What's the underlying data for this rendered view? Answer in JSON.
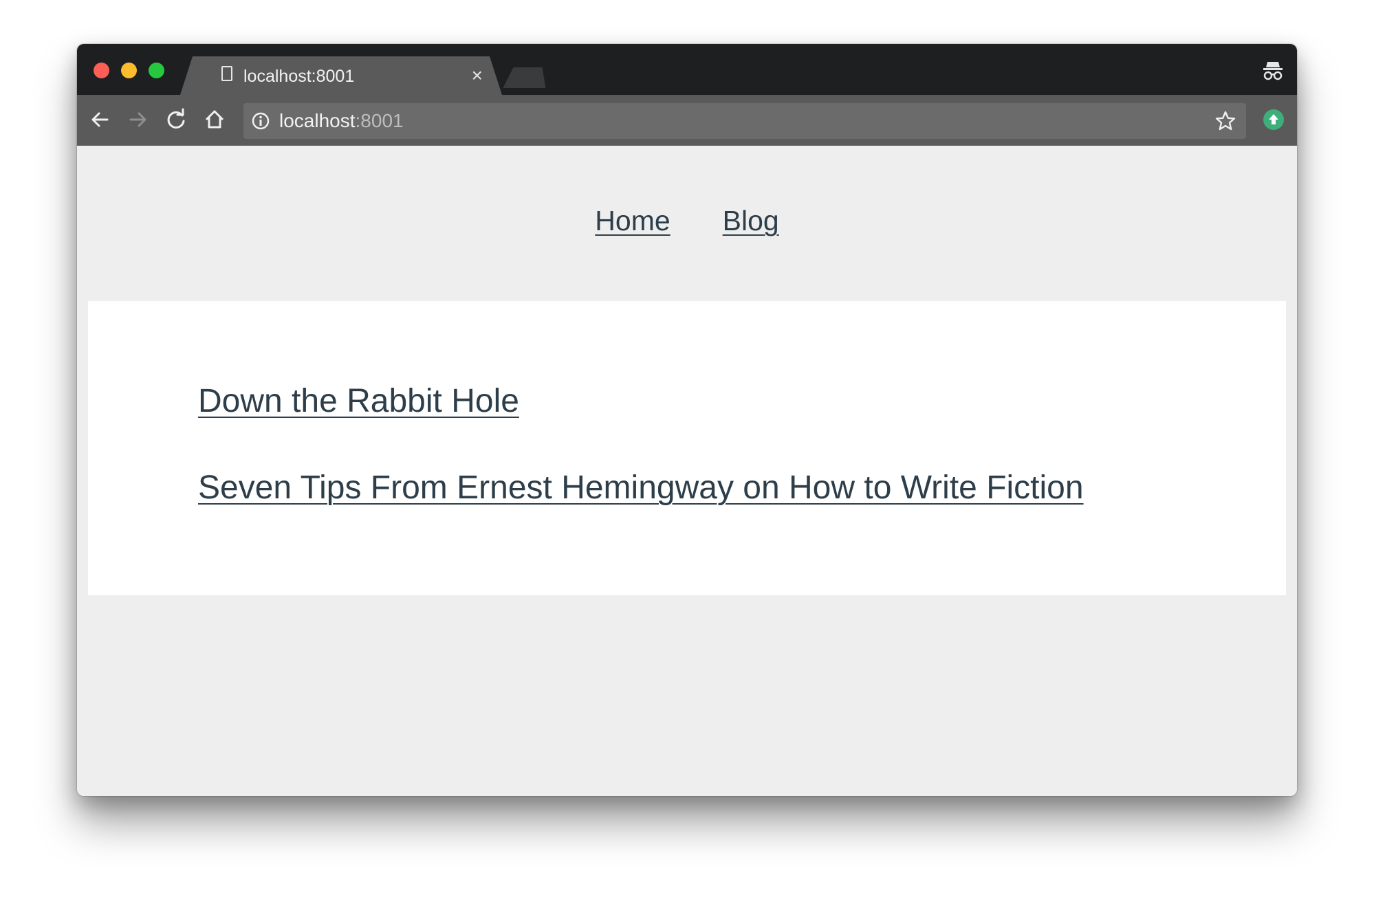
{
  "browser": {
    "tab": {
      "title": "localhost:8001",
      "close_label": "×"
    },
    "address_bar": {
      "host": "localhost",
      "port": ":8001"
    },
    "icons": {
      "page": "document-icon",
      "incognito": "incognito-icon",
      "back": "back-arrow-icon",
      "forward": "forward-arrow-icon",
      "reload": "reload-icon",
      "home": "home-icon",
      "info": "info-icon",
      "bookmark": "star-icon",
      "extension": "upload-extension-icon"
    },
    "colors": {
      "close": "#fd5e56",
      "minimize": "#fdbb2e",
      "maximize": "#27c83f",
      "extension": "#3fae7a",
      "link": "#2d3e4a"
    }
  },
  "site": {
    "nav": [
      {
        "label": "Home"
      },
      {
        "label": "Blog"
      }
    ],
    "posts": [
      {
        "title": "Down the Rabbit Hole"
      },
      {
        "title": "Seven Tips From Ernest Hemingway on How to Write Fiction"
      }
    ]
  }
}
